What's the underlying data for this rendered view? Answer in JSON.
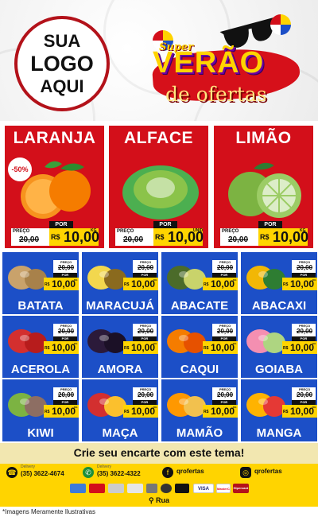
{
  "header": {
    "logo_lines": [
      "SUA",
      "LOGO",
      "AQUI"
    ],
    "title_super": "Super",
    "title_main": "VERÃO",
    "title_sub": "de ofertas"
  },
  "colors": {
    "red": "#d30f1a",
    "blue": "#1c4fc7",
    "yellow": "#ffd400",
    "cream": "#f2e7b0"
  },
  "labels": {
    "preco": "PREÇO",
    "por": "POR",
    "currency": "R$"
  },
  "featured": [
    {
      "name": "LARANJA",
      "old_price": "20,00",
      "price": "10,00",
      "unit": "KG",
      "badge": "-50%",
      "icon": "orange-icon"
    },
    {
      "name": "ALFACE",
      "old_price": "20,00",
      "price": "10,00",
      "unit": "UNID",
      "icon": "lettuce-icon"
    },
    {
      "name": "LIMÃO",
      "old_price": "20,00",
      "price": "10,00",
      "unit": "KG",
      "icon": "lime-icon"
    }
  ],
  "products": [
    {
      "name": "BATATA",
      "old_price": "20,00",
      "price": "10,00",
      "unit": "KG",
      "icon": "potato-icon"
    },
    {
      "name": "MARACUJÁ",
      "old_price": "20,00",
      "price": "10,00",
      "unit": "KG",
      "icon": "passionfruit-icon"
    },
    {
      "name": "ABACATE",
      "old_price": "20,00",
      "price": "10,00",
      "unit": "KG",
      "icon": "avocado-icon"
    },
    {
      "name": "ABACAXI",
      "old_price": "20,00",
      "price": "10,00",
      "unit": "KG",
      "icon": "pineapple-icon"
    },
    {
      "name": "ACEROLA",
      "old_price": "20,00",
      "price": "10,00",
      "unit": "KG",
      "icon": "acerola-icon"
    },
    {
      "name": "AMORA",
      "old_price": "20,00",
      "price": "10,00",
      "unit": "KG",
      "icon": "blackberry-icon"
    },
    {
      "name": "CAQUI",
      "old_price": "20,00",
      "price": "10,00",
      "unit": "KG",
      "icon": "persimmon-icon"
    },
    {
      "name": "GOIABA",
      "old_price": "20,00",
      "price": "10,00",
      "unit": "KG",
      "icon": "guava-icon"
    },
    {
      "name": "KIWI",
      "old_price": "20,00",
      "price": "10,00",
      "unit": "KG",
      "icon": "kiwi-icon"
    },
    {
      "name": "MAÇA",
      "old_price": "20,00",
      "price": "10,00",
      "unit": "KG",
      "icon": "apple-icon"
    },
    {
      "name": "MAMÃO",
      "old_price": "20,00",
      "price": "10,00",
      "unit": "KG",
      "icon": "papaya-icon"
    },
    {
      "name": "MANGA",
      "old_price": "20,00",
      "price": "10,00",
      "unit": "KG",
      "icon": "mango-icon"
    }
  ],
  "footer": {
    "cta": "Crie seu encarte com este tema!",
    "contacts": [
      {
        "label": "Delivery",
        "value": "(35) 3622-4674",
        "icon": "phone-icon"
      },
      {
        "label": "Delivery",
        "value": "(35) 3622-4322",
        "icon": "whatsapp-icon"
      },
      {
        "label": "",
        "value": "qrofertas",
        "icon": "facebook-icon"
      },
      {
        "label": "",
        "value": "qrofertas",
        "icon": "instagram-icon"
      }
    ],
    "payments": [
      "VISA",
      "MasterCard",
      "Hipercard"
    ],
    "address": "Rua",
    "disclaimer": "*Imagens Meramente Ilustrativas"
  }
}
